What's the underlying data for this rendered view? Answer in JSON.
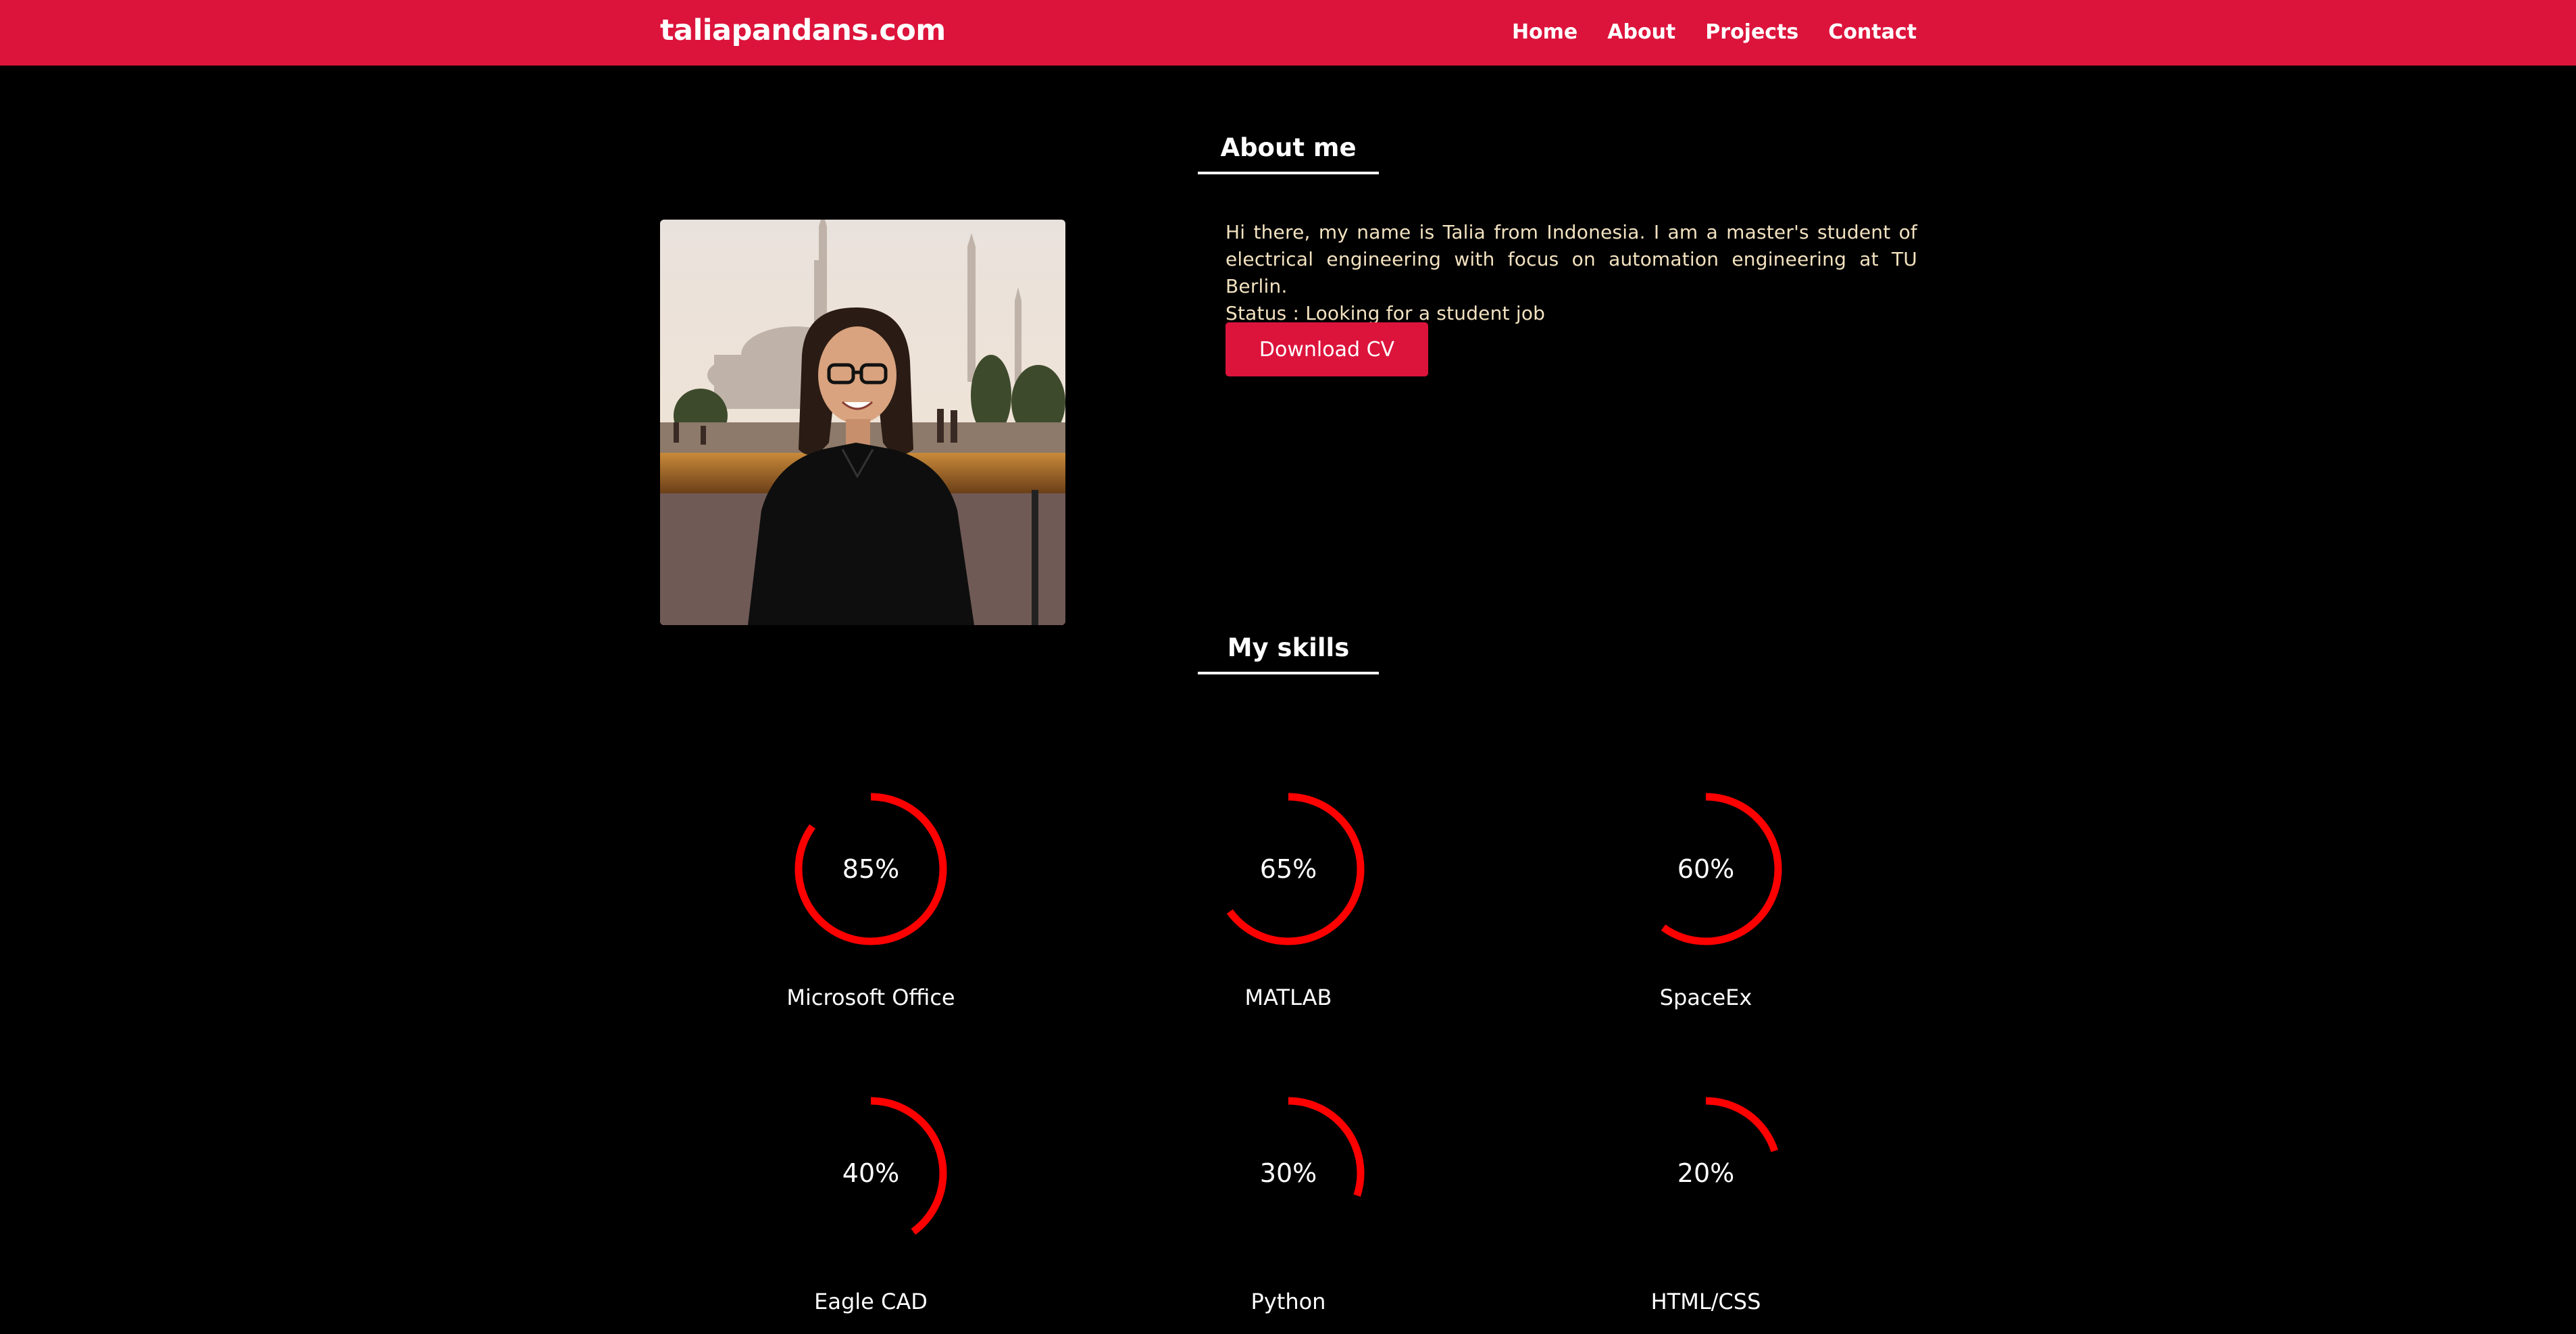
{
  "header": {
    "brand": "taliapandans.com",
    "nav": [
      "Home",
      "About",
      "Projects",
      "Contact"
    ]
  },
  "about": {
    "title": "About me",
    "paragraph": "Hi there, my name is Talia from Indonesia. I am a master's student of electrical engineering with focus on automation engineering at TU Berlin.",
    "status": "Status : Looking for a student job",
    "cv_button": "Download CV"
  },
  "skills": {
    "title": "My skills",
    "items": [
      {
        "name": "Microsoft Office",
        "label": "85%",
        "percent": 85
      },
      {
        "name": "MATLAB",
        "label": "65%",
        "percent": 65
      },
      {
        "name": "SpaceEx",
        "label": "60%",
        "percent": 60
      },
      {
        "name": "Eagle CAD",
        "label": "40%",
        "percent": 40
      },
      {
        "name": "Python",
        "label": "30%",
        "percent": 30
      },
      {
        "name": "HTML/CSS",
        "label": "20%",
        "percent": 20
      }
    ]
  },
  "colors": {
    "brand": "#dc143c",
    "ring": "#ff0000",
    "background": "#000000",
    "about_text": "#f3e2c0"
  }
}
